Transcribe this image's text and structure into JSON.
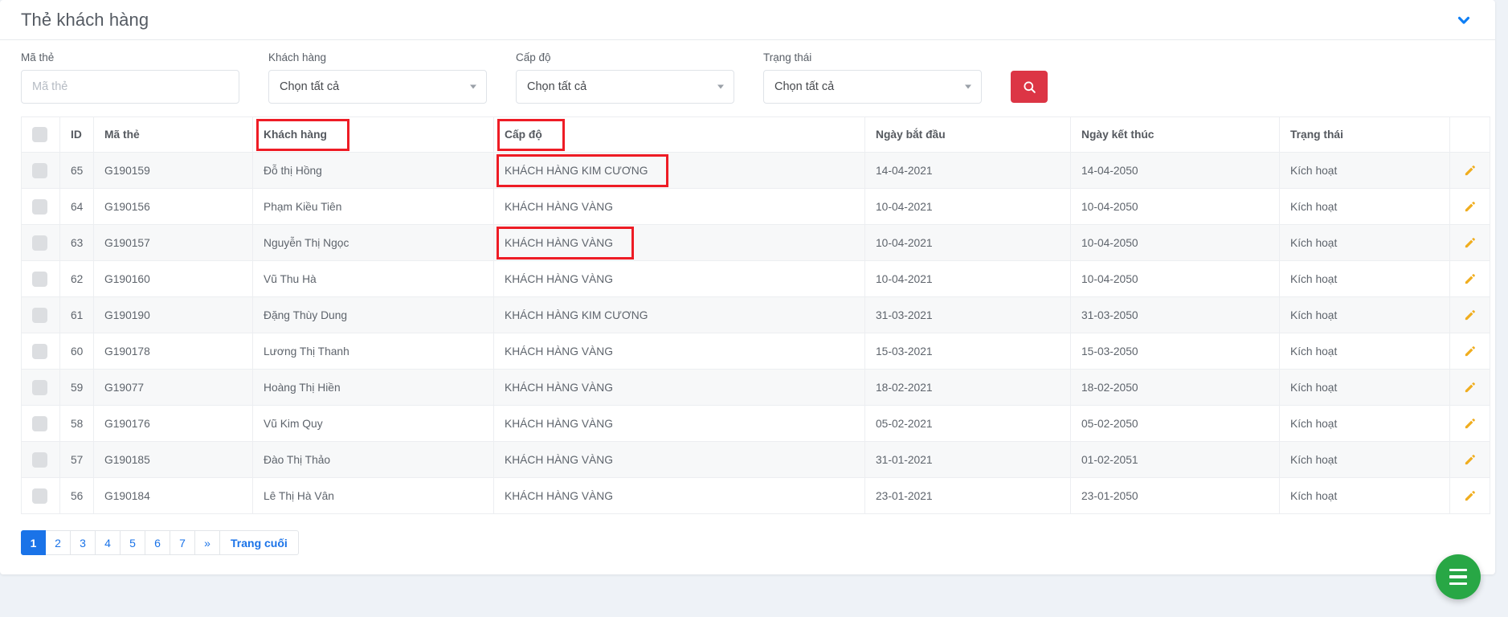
{
  "header": {
    "title": "Thẻ khách hàng",
    "collapse_icon": "chevron-down-icon",
    "accent_blue": "#1a73e8"
  },
  "filters": {
    "card_code": {
      "label": "Mã thẻ",
      "placeholder": "Mã thẻ",
      "value": ""
    },
    "customer": {
      "label": "Khách hàng",
      "value": "Chọn tất cả"
    },
    "level": {
      "label": "Cấp độ",
      "value": "Chọn tất cả"
    },
    "status": {
      "label": "Trạng thái",
      "value": "Chọn tất cả"
    },
    "search_button": {
      "icon": "search-icon",
      "color": "#dc3545"
    }
  },
  "table": {
    "columns": [
      {
        "key": "check",
        "label": ""
      },
      {
        "key": "id",
        "label": "ID"
      },
      {
        "key": "code",
        "label": "Mã thẻ"
      },
      {
        "key": "cust",
        "label": "Khách hàng"
      },
      {
        "key": "level",
        "label": "Cấp độ"
      },
      {
        "key": "start",
        "label": "Ngày bắt đầu"
      },
      {
        "key": "end",
        "label": "Ngày kết thúc"
      },
      {
        "key": "status",
        "label": "Trạng thái"
      },
      {
        "key": "action",
        "label": ""
      }
    ],
    "rows": [
      {
        "id": "65",
        "code": "G190159",
        "cust": "Đỗ thị Hồng",
        "level": "KHÁCH HÀNG KIM CƯƠNG",
        "start": "14-04-2021",
        "end": "14-04-2050",
        "status": "Kích hoạt"
      },
      {
        "id": "64",
        "code": "G190156",
        "cust": "Phạm Kiều Tiên",
        "level": "KHÁCH HÀNG VÀNG",
        "start": "10-04-2021",
        "end": "10-04-2050",
        "status": "Kích hoạt"
      },
      {
        "id": "63",
        "code": "G190157",
        "cust": "Nguyễn Thị Ngọc",
        "level": "KHÁCH HÀNG VÀNG",
        "start": "10-04-2021",
        "end": "10-04-2050",
        "status": "Kích hoạt"
      },
      {
        "id": "62",
        "code": "G190160",
        "cust": "Vũ Thu Hà",
        "level": "KHÁCH HÀNG VÀNG",
        "start": "10-04-2021",
        "end": "10-04-2050",
        "status": "Kích hoạt"
      },
      {
        "id": "61",
        "code": "G190190",
        "cust": "Đặng Thùy Dung",
        "level": "KHÁCH HÀNG KIM CƯƠNG",
        "start": "31-03-2021",
        "end": "31-03-2050",
        "status": "Kích hoạt"
      },
      {
        "id": "60",
        "code": "G190178",
        "cust": "Lương Thị Thanh",
        "level": "KHÁCH HÀNG VÀNG",
        "start": "15-03-2021",
        "end": "15-03-2050",
        "status": "Kích hoạt"
      },
      {
        "id": "59",
        "code": "G19077",
        "cust": "Hoàng Thị Hiền",
        "level": "KHÁCH HÀNG VÀNG",
        "start": "18-02-2021",
        "end": "18-02-2050",
        "status": "Kích hoạt"
      },
      {
        "id": "58",
        "code": "G190176",
        "cust": "Vũ Kim Quy",
        "level": "KHÁCH HÀNG VÀNG",
        "start": "05-02-2021",
        "end": "05-02-2050",
        "status": "Kích hoạt"
      },
      {
        "id": "57",
        "code": "G190185",
        "cust": "Đào Thị Thảo",
        "level": "KHÁCH HÀNG VÀNG",
        "start": "31-01-2021",
        "end": "01-02-2051",
        "status": "Kích hoạt"
      },
      {
        "id": "56",
        "code": "G190184",
        "cust": "Lê Thị Hà Vân",
        "level": "KHÁCH HÀNG VÀNG",
        "start": "23-01-2021",
        "end": "23-01-2050",
        "status": "Kích hoạt"
      }
    ],
    "row_action_icon": "pencil-edit-icon",
    "row_action_color": "#f0ad1e"
  },
  "annotations": {
    "color": "#ee1c25",
    "boxes": [
      "header-khach-hang",
      "header-cap-do",
      "row-0-level",
      "row-2-level"
    ]
  },
  "pagination": {
    "pages": [
      "1",
      "2",
      "3",
      "4",
      "5",
      "6",
      "7"
    ],
    "next_label": "»",
    "last_label": "Trang cuối",
    "active": "1"
  },
  "fab": {
    "icon": "hamburger-menu-icon",
    "color": "#28a745"
  }
}
